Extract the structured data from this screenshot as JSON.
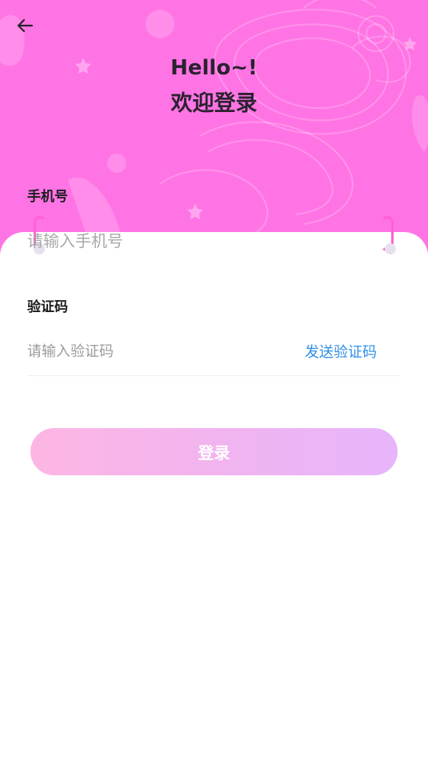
{
  "header": {
    "greeting_line1": "Hello~!",
    "greeting_line2": "欢迎登录"
  },
  "form": {
    "phone_label": "手机号",
    "phone_placeholder": "请输入手机号",
    "code_label": "验证码",
    "code_placeholder": "请输入验证码",
    "send_code_label": "发送验证码",
    "login_label": "登录"
  },
  "colors": {
    "hero_background": "#ff74e4",
    "accent_link": "#2e8ee8",
    "button_gradient_start": "#fdb2e2",
    "button_gradient_end": "#e6b1fb"
  },
  "icons": {
    "back": "arrow-left-icon"
  }
}
